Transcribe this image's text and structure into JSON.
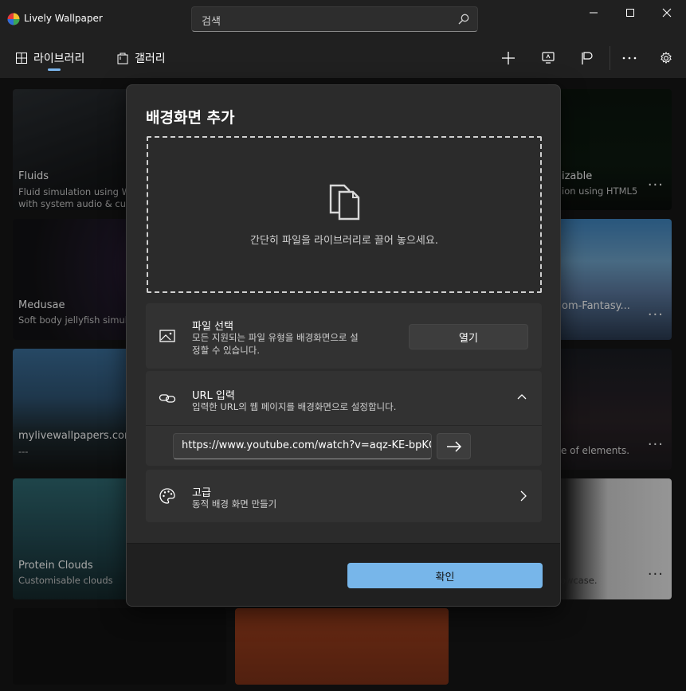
{
  "app": {
    "title": "Lively Wallpaper"
  },
  "search": {
    "placeholder": "검색"
  },
  "nav": {
    "library": "라이브러리",
    "gallery": "갤러리"
  },
  "tiles": [
    {
      "title": "Fluids",
      "desc1": "Fluid simulation using W",
      "desc2": "with system audio & cur"
    },
    {
      "title": "Medusae",
      "desc1": "Soft body jellyfish simula",
      "desc2": ""
    },
    {
      "title": "mylivewallpapers.com",
      "desc1": "---",
      "desc2": ""
    },
    {
      "title": "Protein Clouds",
      "desc1": "Customisable clouds",
      "desc2": ""
    },
    {
      "title": "izable",
      "desc1": "ion using HTML5",
      "desc2": ""
    },
    {
      "title": "om-Fantasy...",
      "desc1": "",
      "desc2": ""
    },
    {
      "title": "",
      "desc1": "ble of elements.",
      "desc2": ""
    },
    {
      "title": "",
      "desc1": "owcase.",
      "desc2": ""
    }
  ],
  "dialog": {
    "title": "배경화면 추가",
    "drop_text": "간단히 파일을 라이브러리로 끌어 놓으세요.",
    "file": {
      "title": "파일 선택",
      "desc_line1": "모든 지원되는 파일 유형을 배경화면으로 설",
      "desc_line2": "정할 수 있습니다.",
      "button": "열기"
    },
    "url": {
      "title": "URL 입력",
      "desc": "입력한 URL의 웹 페이지를 배경화면으로 설정합니다.",
      "value": "https://www.youtube.com/watch?v=aqz-KE-bpKQ"
    },
    "advanced": {
      "title": "고급",
      "desc": "동적 배경 화면 만들기"
    },
    "ok": "확인"
  },
  "colors": {
    "accent": "#77b6ea"
  }
}
